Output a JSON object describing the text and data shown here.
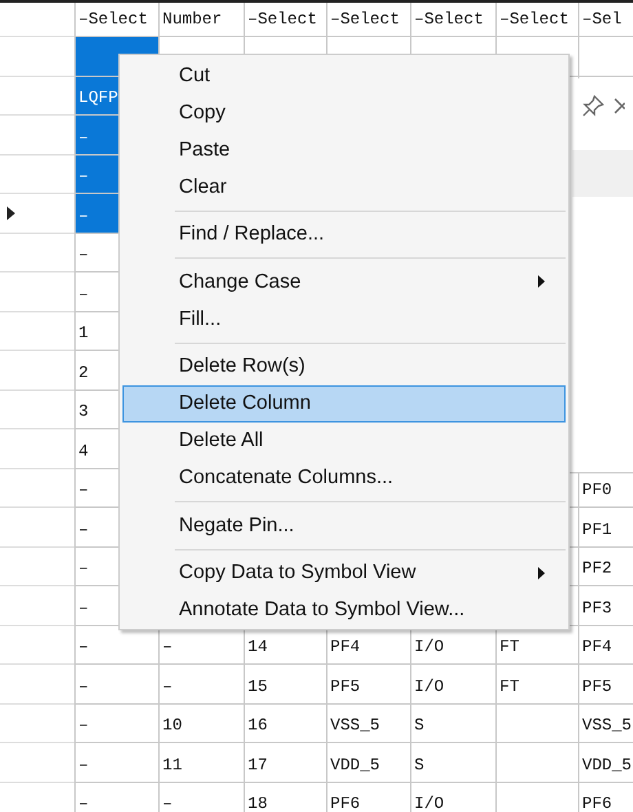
{
  "table": {
    "columns": [
      "–Select",
      "Number",
      "–Select",
      "–Select",
      "–Select",
      "–Select",
      "–Sel"
    ],
    "rows": [
      {
        "selected": true,
        "current": false,
        "cells": {}
      },
      {
        "selected": true,
        "current": false,
        "cells": {
          "column_1": "LQFP"
        }
      },
      {
        "selected": true,
        "current": false,
        "cells": {
          "column_1": "–"
        }
      },
      {
        "selected": true,
        "current": false,
        "cells": {
          "column_1": "–"
        }
      },
      {
        "selected": true,
        "current": true,
        "cells": {
          "column_1": "–"
        }
      },
      {
        "selected": false,
        "current": false,
        "cells": {
          "column_1": "–"
        }
      },
      {
        "selected": false,
        "current": false,
        "cells": {
          "column_1": "–"
        }
      },
      {
        "selected": false,
        "current": false,
        "cells": {
          "column_1": "1"
        }
      },
      {
        "selected": false,
        "current": false,
        "cells": {
          "column_1": "2"
        }
      },
      {
        "selected": false,
        "current": false,
        "cells": {
          "column_1": "3"
        }
      },
      {
        "selected": false,
        "current": false,
        "cells": {
          "column_1": "4"
        }
      },
      {
        "selected": false,
        "current": false,
        "cells": {
          "column_1": "–",
          "column_7": "PF0"
        }
      },
      {
        "selected": false,
        "current": false,
        "cells": {
          "column_1": "–",
          "column_7": "PF1"
        }
      },
      {
        "selected": false,
        "current": false,
        "cells": {
          "column_1": "–",
          "column_7": "PF2"
        }
      },
      {
        "selected": false,
        "current": false,
        "cells": {
          "column_1": "–",
          "column_7": "PF3"
        }
      },
      {
        "selected": false,
        "current": false,
        "cells": {
          "column_1": "–",
          "column_2": "–",
          "column_3": "14",
          "column_4": "PF4",
          "column_5": "I/O",
          "column_6": "FT",
          "column_7": "PF4"
        }
      },
      {
        "selected": false,
        "current": false,
        "cells": {
          "column_1": "–",
          "column_2": "–",
          "column_3": "15",
          "column_4": "PF5",
          "column_5": "I/O",
          "column_6": "FT",
          "column_7": "PF5"
        }
      },
      {
        "selected": false,
        "current": false,
        "cells": {
          "column_1": "–",
          "column_2": "10",
          "column_3": "16",
          "column_4": "VSS_5",
          "column_5": "S",
          "column_7": "VSS_5"
        }
      },
      {
        "selected": false,
        "current": false,
        "cells": {
          "column_1": "–",
          "column_2": "11",
          "column_3": "17",
          "column_4": "VDD_5",
          "column_5": "S",
          "column_7": "VDD_5"
        }
      },
      {
        "selected": false,
        "current": false,
        "cells": {
          "column_1": "–",
          "column_2": "–",
          "column_3": "18",
          "column_4": "PF6",
          "column_5": "I/O",
          "column_7": "PF6"
        }
      }
    ]
  },
  "context_menu": {
    "items": [
      {
        "kind": "item",
        "label": "Cut",
        "submenu": false,
        "selected": false
      },
      {
        "kind": "item",
        "label": "Copy",
        "submenu": false,
        "selected": false
      },
      {
        "kind": "item",
        "label": "Paste",
        "submenu": false,
        "selected": false
      },
      {
        "kind": "item",
        "label": "Clear",
        "submenu": false,
        "selected": false
      },
      {
        "kind": "separator"
      },
      {
        "kind": "item",
        "label": "Find / Replace...",
        "submenu": false,
        "selected": false
      },
      {
        "kind": "separator"
      },
      {
        "kind": "item",
        "label": "Change Case",
        "submenu": true,
        "selected": false
      },
      {
        "kind": "item",
        "label": "Fill...",
        "submenu": false,
        "selected": false
      },
      {
        "kind": "separator"
      },
      {
        "kind": "item",
        "label": "Delete Row(s)",
        "submenu": false,
        "selected": false
      },
      {
        "kind": "item",
        "label": "Delete Column",
        "submenu": false,
        "selected": true
      },
      {
        "kind": "item",
        "label": "Delete All",
        "submenu": false,
        "selected": false
      },
      {
        "kind": "item",
        "label": "Concatenate Columns...",
        "submenu": false,
        "selected": false
      },
      {
        "kind": "separator"
      },
      {
        "kind": "item",
        "label": "Negate Pin...",
        "submenu": false,
        "selected": false
      },
      {
        "kind": "separator"
      },
      {
        "kind": "item",
        "label": "Copy Data to Symbol View",
        "submenu": true,
        "selected": false
      },
      {
        "kind": "item",
        "label": "Annotate Data to Symbol View...",
        "submenu": false,
        "selected": false
      }
    ]
  }
}
